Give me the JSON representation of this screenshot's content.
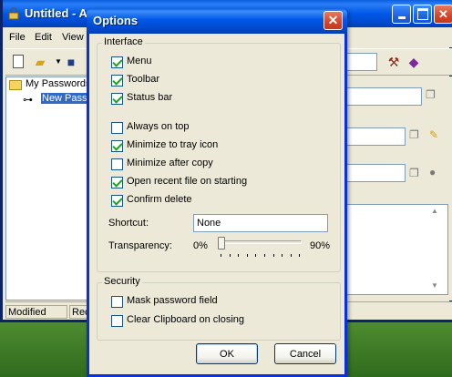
{
  "app": {
    "title": "Untitled - A",
    "menu": [
      "File",
      "Edit",
      "View"
    ],
    "tree": {
      "root": "My Passwords",
      "entry": "New Passw"
    },
    "status": {
      "modified": "Modified",
      "records": "Reco"
    }
  },
  "dialog": {
    "title": "Options",
    "close_glyph": "✕",
    "interface_group": {
      "label": "Interface",
      "options": [
        {
          "label": "Menu",
          "checked": true
        },
        {
          "label": "Toolbar",
          "checked": true
        },
        {
          "label": "Status bar",
          "checked": true
        },
        {
          "label": "Always on top",
          "checked": false
        },
        {
          "label": "Minimize to tray icon",
          "checked": true
        },
        {
          "label": "Minimize after copy",
          "checked": false
        },
        {
          "label": "Open recent file on starting",
          "checked": true
        },
        {
          "label": "Confirm delete",
          "checked": true
        }
      ],
      "shortcut_label": "Shortcut:",
      "shortcut_value": "None",
      "transparency_label": "Transparency:",
      "transparency_min": "0%",
      "transparency_max": "90%",
      "transparency_value": 0
    },
    "security_group": {
      "label": "Security",
      "options": [
        {
          "label": "Mask password field",
          "checked": false
        },
        {
          "label": "Clear Clipboard on closing",
          "checked": false
        }
      ]
    },
    "buttons": {
      "ok": "OK",
      "cancel": "Cancel"
    }
  },
  "icons": {
    "app": "padlock-icon",
    "minimize": "minimize-icon",
    "maximize": "maximize-icon",
    "close": "close-icon",
    "folder": "folder-icon",
    "key": "key-icon"
  },
  "colors": {
    "titlebar": "#0058e8",
    "window_face": "#ece9d8",
    "close_button": "#d4452a",
    "selection": "#316ac5"
  }
}
